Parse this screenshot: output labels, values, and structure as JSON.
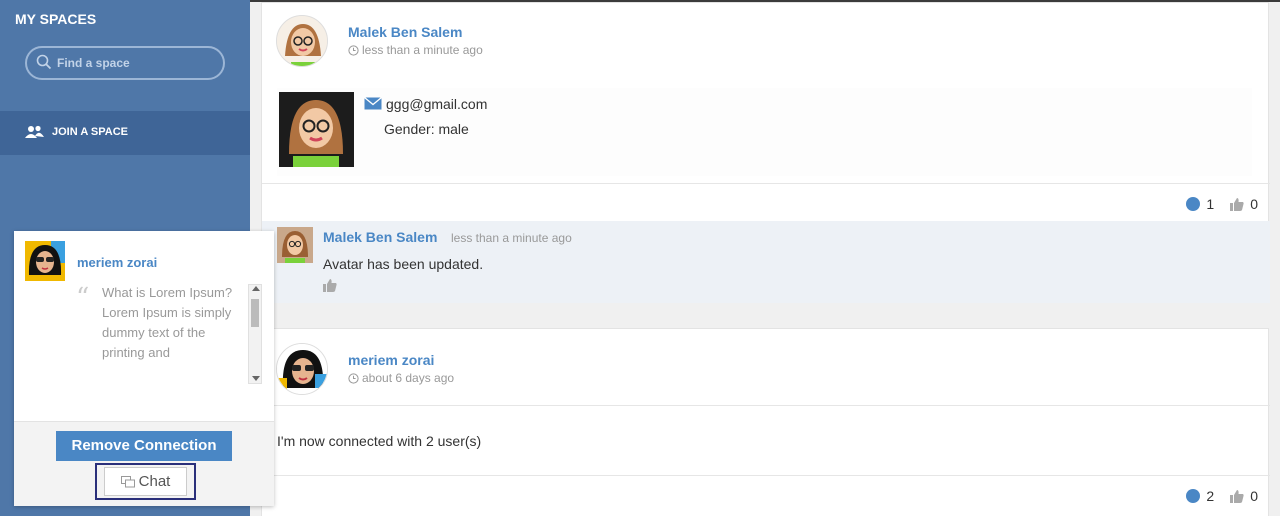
{
  "sidebar": {
    "title": "MY SPACES",
    "search_placeholder": "Find a space",
    "join_label": "JOIN A SPACE"
  },
  "posts": [
    {
      "author": "Malek Ben Salem",
      "time": "less than a minute ago",
      "email": "ggg@gmail.com",
      "gender": "Gender: male",
      "comment_count": "1",
      "like_count": "0",
      "comment": {
        "author": "Malek Ben Salem",
        "time": "less than a minute ago",
        "text": "Avatar has been updated."
      }
    },
    {
      "author": "meriem zorai",
      "time": "about 6 days ago",
      "text": "I'm now connected with 2 user(s)",
      "comment_count": "2",
      "like_count": "0"
    }
  ],
  "popup": {
    "name": "meriem zorai",
    "quote": "What is Lorem Ipsum? Lorem Ipsum is simply dummy text of the printing and",
    "remove_label": "Remove Connection",
    "chat_label": "Chat"
  },
  "colors": {
    "sidebar_bg": "#4f77a8",
    "accent": "#4a87c5"
  }
}
